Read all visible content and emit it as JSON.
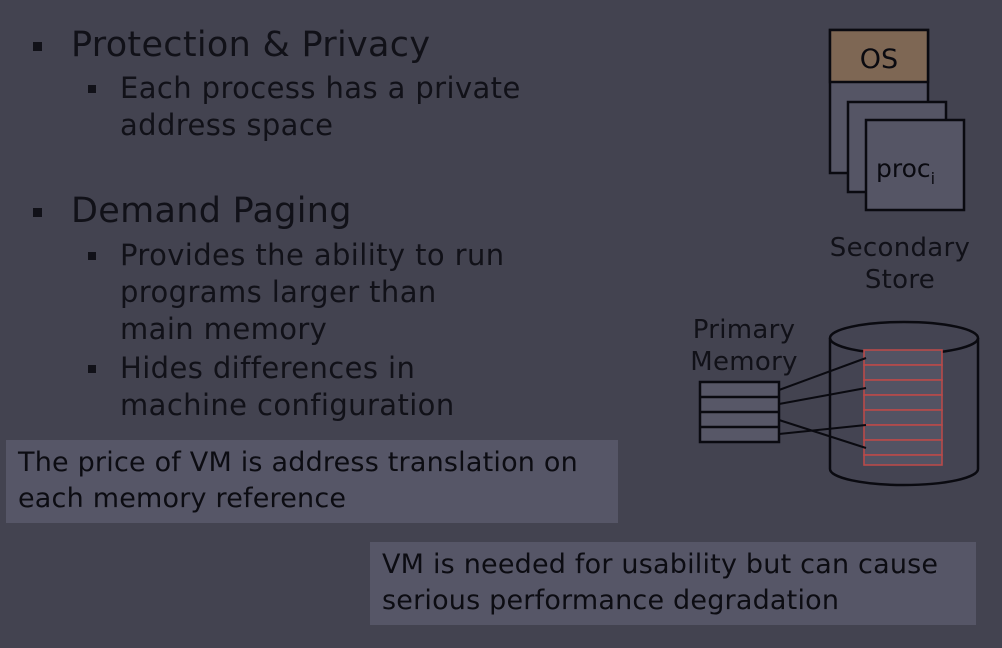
{
  "bullets": [
    {
      "heading": "Protection & Privacy",
      "subs": [
        {
          "line1": "Each process has a private",
          "line2": "address space"
        }
      ]
    },
    {
      "heading": "Demand Paging",
      "subs": [
        {
          "line1": "Provides the ability to run",
          "line2": "programs larger than",
          "line3": "main memory"
        },
        {
          "line1": "Hides differences in",
          "line2": "machine configuration"
        }
      ]
    }
  ],
  "callouts": {
    "price": {
      "line1": "The price of VM is address translation on",
      "line2": "each memory reference"
    },
    "usability": {
      "line1": "VM is needed for usability but can cause",
      "line2": "serious performance degradation"
    }
  },
  "diagram": {
    "os_label": "OS",
    "proc_label": "proc",
    "proc_subscript": "i",
    "secondary_store": {
      "line1": "Secondary",
      "line2": "Store"
    },
    "primary_memory": {
      "line1": "Primary",
      "line2": "Memory"
    },
    "colors": {
      "os_fill": "#7e6754",
      "page_border": "#b84a4a",
      "stroke": "#0a0a10"
    }
  }
}
